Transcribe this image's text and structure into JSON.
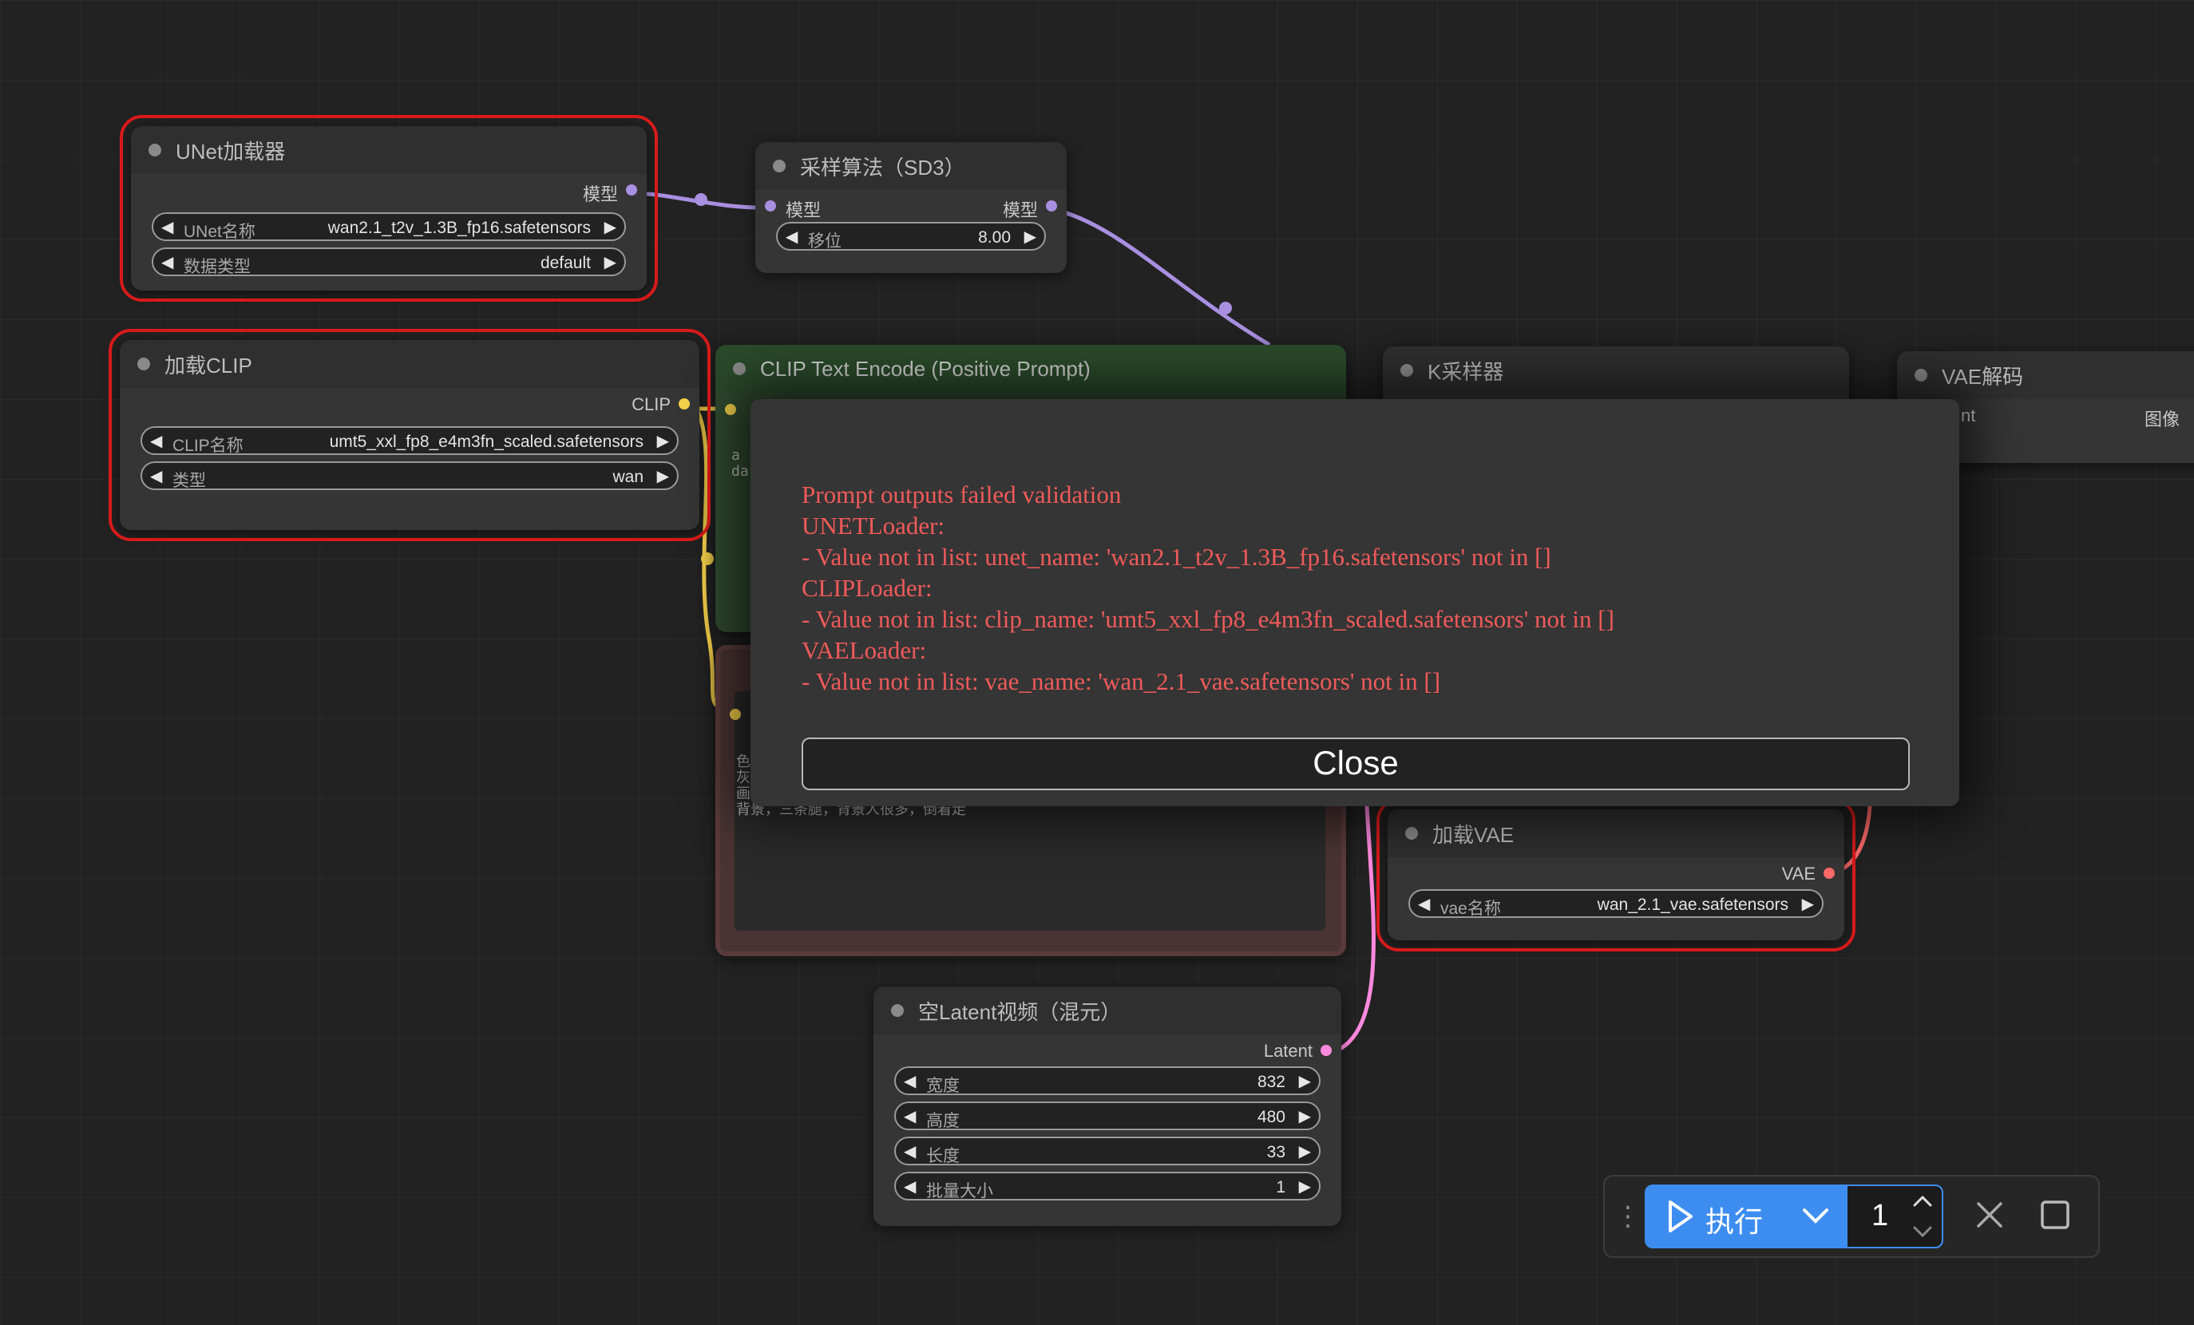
{
  "colors": {
    "model": "#a98fe0",
    "clip": "#f5d04a",
    "vae": "#ff6a6a",
    "latent": "#ff8adf",
    "error": "#d81a1a",
    "accent": "#3d8df0"
  },
  "unet_loader": {
    "title": "UNet加载器",
    "output": "模型",
    "widgets": [
      {
        "label": "UNet名称",
        "value": "wan2.1_t2v_1.3B_fp16.safetensors"
      },
      {
        "label": "数据类型",
        "value": "default"
      }
    ]
  },
  "sampling": {
    "title": "采样算法（SD3）",
    "input": "模型",
    "output": "模型",
    "widgets": [
      {
        "label": "移位",
        "value": "8.00"
      }
    ]
  },
  "clip_loader": {
    "title": "加载CLIP",
    "output": "CLIP",
    "widgets": [
      {
        "label": "CLIP名称",
        "value": "umt5_xxl_fp8_e4m3fn_scaled.safetensors"
      },
      {
        "label": "类型",
        "value": "wan"
      }
    ]
  },
  "clip_positive": {
    "title": "CLIP Text Encode (Positive Prompt)",
    "text_a": "a",
    "text_b": "da"
  },
  "negative": {
    "text_1": "色",
    "text_2": "灰",
    "text_3": "画",
    "text_4": "背景，三条腿，背景人很多，倒着走"
  },
  "ksampler": {
    "title": "K采样器"
  },
  "vae_decode": {
    "title": "VAE解码",
    "input": "nt",
    "output": "图像"
  },
  "vae_loader": {
    "title": "加载VAE",
    "output": "VAE",
    "widgets": [
      {
        "label": "vae名称",
        "value": "wan_2.1_vae.safetensors"
      }
    ]
  },
  "empty_latent": {
    "title": "空Latent视频（混元）",
    "output": "Latent",
    "widgets": [
      {
        "label": "宽度",
        "value": "832"
      },
      {
        "label": "高度",
        "value": "480"
      },
      {
        "label": "长度",
        "value": "33"
      },
      {
        "label": "批量大小",
        "value": "1"
      }
    ]
  },
  "dialog": {
    "message": "Prompt outputs failed validation\nUNETLoader:\n- Value not in list: unet_name: 'wan2.1_t2v_1.3B_fp16.safetensors' not in []\nCLIPLoader:\n- Value not in list: clip_name: 'umt5_xxl_fp8_e4m3fn_scaled.safetensors' not in []\nVAELoader:\n- Value not in list: vae_name: 'wan_2.1_vae.safetensors' not in []",
    "close_label": "Close"
  },
  "toolbar": {
    "run_label": "执行",
    "count": "1",
    "icons": [
      "drag-grip-icon",
      "play-icon",
      "chevron-down-icon",
      "chevron-up-icon",
      "close-icon",
      "stop-square-icon"
    ]
  }
}
